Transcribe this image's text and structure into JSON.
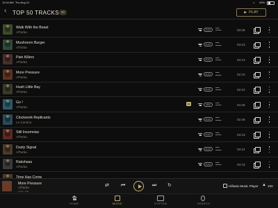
{
  "status": {
    "time": "11:04 AM",
    "date": "Thu Aug 21",
    "battery": "49%"
  },
  "header": {
    "back_icon": "chevron-left-icon",
    "title": "TOP 50 TRACKS",
    "count": "50",
    "play_label": "PLAY"
  },
  "colors": {
    "accent": "#c9b27a",
    "background": "#0d0d0d",
    "text": "#e9e3d8",
    "muted": "#8e8676"
  },
  "tracks": [
    {
      "title": "Walk With the Beast",
      "artist": "AfTarba",
      "duration": "03:26",
      "badge": "FLAC",
      "art_color": "#3a4a2a"
    },
    {
      "title": "Mushroom Burger",
      "artist": "AfTarba",
      "duration": "03:23",
      "badge": "FLAC",
      "art_color": "#2e4a3a"
    },
    {
      "title": "Pain Killers",
      "artist": "AfTarba",
      "duration": "03:13",
      "badge": "FLAC",
      "art_color": "#4a2e2a"
    },
    {
      "title": "More Pressure",
      "artist": "AfTarba",
      "duration": "02:16",
      "badge": "FLAC",
      "art_color": "#5a3322"
    },
    {
      "title": "Hush Little Bay",
      "artist": "AfTarba",
      "duration": "02:22",
      "badge": "FLAC",
      "art_color": "#3a3a2a"
    },
    {
      "title": "Go !",
      "artist": "AfTarba",
      "duration": "04:35",
      "badge": "MP3",
      "art_color": "#2a5a6a",
      "hq": "HQ"
    },
    {
      "title": "Clockwork Replicants",
      "artist": "Le Cantina",
      "duration": "02:48",
      "badge": "FLAC",
      "art_color": "#2a4a5a"
    },
    {
      "title": "Still Insomniac",
      "artist": "AfTarba",
      "duration": "03:23",
      "badge": "FLAC",
      "art_color": "#5a2a22"
    },
    {
      "title": "Dusty Signal",
      "artist": "AfTarba",
      "duration": "03:24",
      "badge": "FLAC",
      "art_color": "#4a3a2a"
    },
    {
      "title": "Rakshasa",
      "artist": "AfTarba",
      "duration": "03:43",
      "badge": "FLAC",
      "art_color": "#3a3a3a"
    },
    {
      "title": "Time Has Come",
      "artist": "",
      "duration": "",
      "badge": "",
      "art_color": "#4a3a2a"
    }
  ],
  "player": {
    "title": "More Pressure",
    "artist": "AfTarba",
    "sub": "FLAC / 44k",
    "output_label": "Hifiasio Music Player",
    "volume": "100"
  },
  "tabs": [
    {
      "label": "HOME",
      "icon": "home-icon"
    },
    {
      "label": "MUSIC",
      "icon": "music-icon",
      "active": true
    },
    {
      "label": "SYSTEM",
      "icon": "system-icon"
    },
    {
      "label": "SEARCH",
      "icon": "search-icon"
    }
  ]
}
